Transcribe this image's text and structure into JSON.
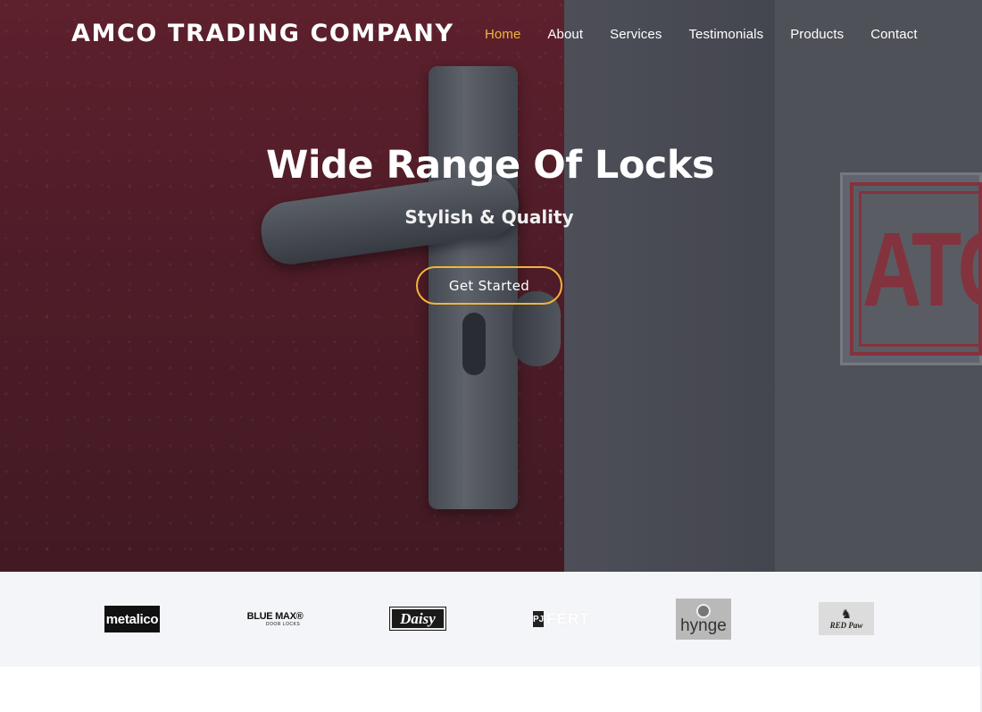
{
  "brand": "AMCO TRADING COMPANY",
  "nav": [
    {
      "label": "Home",
      "active": true
    },
    {
      "label": "About",
      "active": false
    },
    {
      "label": "Services",
      "active": false
    },
    {
      "label": "Testimonials",
      "active": false
    },
    {
      "label": "Products",
      "active": false
    },
    {
      "label": "Contact",
      "active": false
    }
  ],
  "hero": {
    "title": "Wide Range Of Locks",
    "subtitle": "Stylish & Quality",
    "cta": "Get Started",
    "side_logo": "ATC"
  },
  "clients": [
    {
      "name": "metalico-logo",
      "text": "metalico"
    },
    {
      "name": "bluemax-logo",
      "text": "BLUE MAX®",
      "sub": "DOOR LOCKS"
    },
    {
      "name": "daisy-logo",
      "text": "Daisy"
    },
    {
      "name": "pj-logo",
      "mark": "PJ",
      "text": "FERT"
    },
    {
      "name": "hynge-logo",
      "text": "hynge"
    },
    {
      "name": "redpaw-logo",
      "text": "RED Paw"
    }
  ],
  "colors": {
    "accent": "#f2b43a",
    "nav_text": "#ffffff",
    "clients_bg": "#f4f5f8"
  }
}
